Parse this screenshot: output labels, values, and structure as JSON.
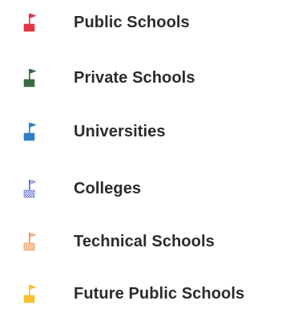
{
  "legend": {
    "items": [
      {
        "label": "Public Schools",
        "icon": "solid-flag-icon",
        "color": "#e23645",
        "pattern": "solid"
      },
      {
        "label": "Private Schools",
        "icon": "solid-flag-icon",
        "color": "#3a6b3f",
        "pattern": "solid"
      },
      {
        "label": "Universities",
        "icon": "solid-flag-icon",
        "color": "#2f7fc4",
        "pattern": "solid"
      },
      {
        "label": "Colleges",
        "icon": "checkered-flag-icon",
        "color": "#5b6fd0",
        "pattern": "checkered"
      },
      {
        "label": "Technical Schools",
        "icon": "checkered-flag-icon",
        "color": "#f08a3c",
        "pattern": "checkered"
      },
      {
        "label": "Future Public Schools",
        "icon": "solid-flag-icon",
        "color": "#f6c232",
        "pattern": "solid"
      }
    ]
  }
}
